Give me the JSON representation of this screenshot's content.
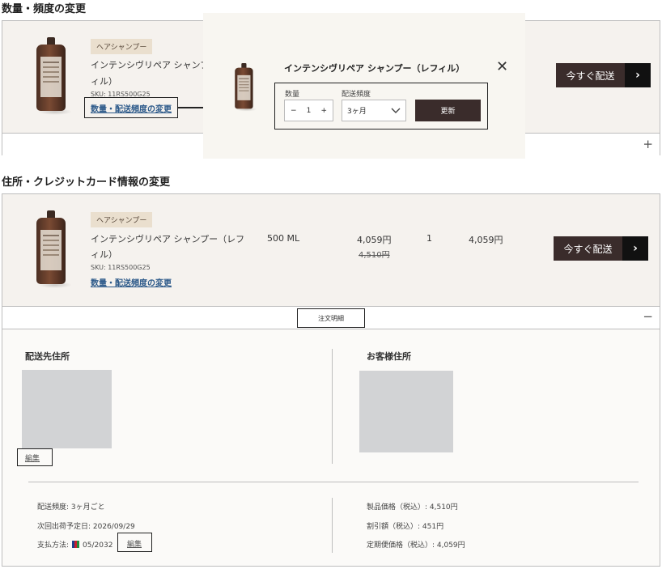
{
  "section1": {
    "title": "数量・頻度の変更"
  },
  "section2": {
    "title": "住所・クレジットカード情報の変更"
  },
  "product": {
    "badge": "ヘアシャンプー",
    "name_line1": "インテンシヴリペア シャンプー（レフ",
    "name_line2": "ィル）",
    "sku": "SKU: 11RS500G25",
    "change_link": "数量・配送頻度の変更"
  },
  "card1": {
    "name_line1": "インテンシヴリペア シャンプー（",
    "name_line2": "ィル）"
  },
  "deliver_now": "今すぐ配送",
  "popup": {
    "title": "インテンシヴリペア シャンプー（レフィル）",
    "quantity_label": "数量",
    "quantity_value": "1",
    "minus": "−",
    "plus": "+",
    "frequency_label": "配送頻度",
    "frequency_value": "3ヶ月",
    "update_button": "更新"
  },
  "row": {
    "size": "500 ML",
    "price": "4,059円",
    "original_price": "4,510円",
    "qty": "1",
    "total": "4,059円"
  },
  "order_details_button": "注文明細",
  "shipping_address_heading": "配送先住所",
  "billing_address_heading": "お客様住所",
  "edit_label": "編集",
  "summary": {
    "frequency": "配送頻度: 3ヶ月ごと",
    "next_ship": "次回出荷予定日: 2026/09/29",
    "payment_label": "支払方法:",
    "payment_expiry": "05/2032",
    "product_price": "製品価格（税込）: 4,510円",
    "discount": "割引額（税込）: 451円",
    "subscription_price": "定期便価格（税込）: 4,059円"
  },
  "icons": {
    "plus": "+",
    "minus": "−",
    "close": "✕",
    "chevron_right": "›",
    "chevron_down": "⌄"
  }
}
